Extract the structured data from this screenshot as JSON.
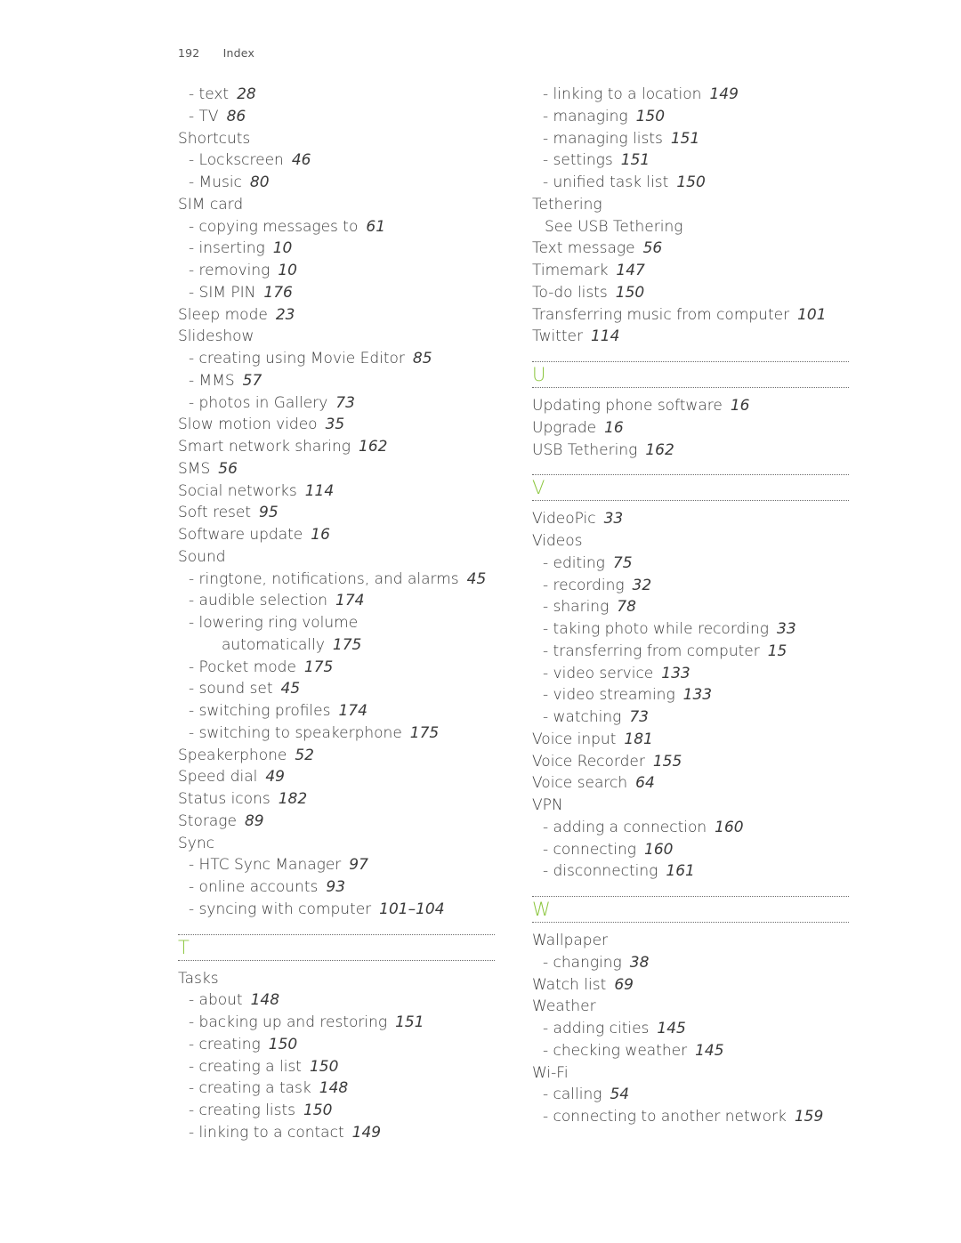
{
  "header": {
    "page_number": "192",
    "section": "Index"
  },
  "accent_color": "#8cc63f",
  "columns": [
    [
      {
        "type": "sub",
        "text": "- text",
        "page": "28"
      },
      {
        "type": "sub",
        "text": "- TV",
        "page": "86"
      },
      {
        "type": "main",
        "text": "Shortcuts",
        "page": ""
      },
      {
        "type": "sub",
        "text": "- Lockscreen",
        "page": "46"
      },
      {
        "type": "sub",
        "text": "- Music",
        "page": "80"
      },
      {
        "type": "main",
        "text": "SIM card",
        "page": ""
      },
      {
        "type": "sub",
        "text": "- copying messages to",
        "page": "61"
      },
      {
        "type": "sub",
        "text": "- inserting",
        "page": "10"
      },
      {
        "type": "sub",
        "text": "- removing",
        "page": "10"
      },
      {
        "type": "sub",
        "text": "- SIM PIN",
        "page": "176"
      },
      {
        "type": "main",
        "text": "Sleep mode",
        "page": "23"
      },
      {
        "type": "main",
        "text": "Slideshow",
        "page": ""
      },
      {
        "type": "sub",
        "text": "- creating using Movie Editor",
        "page": "85"
      },
      {
        "type": "sub",
        "text": "- MMS",
        "page": "57"
      },
      {
        "type": "sub",
        "text": "- photos in Gallery",
        "page": "73"
      },
      {
        "type": "main",
        "text": "Slow motion video",
        "page": "35"
      },
      {
        "type": "main",
        "text": "Smart network sharing",
        "page": "162"
      },
      {
        "type": "main",
        "text": "SMS",
        "page": "56"
      },
      {
        "type": "main",
        "text": "Social networks",
        "page": "114"
      },
      {
        "type": "main",
        "text": "Soft reset",
        "page": "95"
      },
      {
        "type": "main",
        "text": "Software update",
        "page": "16"
      },
      {
        "type": "main",
        "text": "Sound",
        "page": ""
      },
      {
        "type": "sub",
        "text": "- ringtone, notifications, and alarms",
        "page": "45"
      },
      {
        "type": "sub",
        "text": "- audible selection",
        "page": "174"
      },
      {
        "type": "sub",
        "text": "- lowering ring volume",
        "page": ""
      },
      {
        "type": "subcont",
        "text": "automatically",
        "page": "175"
      },
      {
        "type": "sub",
        "text": "- Pocket mode",
        "page": "175"
      },
      {
        "type": "sub",
        "text": "- sound set",
        "page": "45"
      },
      {
        "type": "sub",
        "text": "- switching profiles",
        "page": "174"
      },
      {
        "type": "sub",
        "text": "- switching to speakerphone",
        "page": "175"
      },
      {
        "type": "main",
        "text": "Speakerphone",
        "page": "52"
      },
      {
        "type": "main",
        "text": "Speed dial",
        "page": "49"
      },
      {
        "type": "main",
        "text": "Status icons",
        "page": "182"
      },
      {
        "type": "main",
        "text": "Storage",
        "page": "89"
      },
      {
        "type": "main",
        "text": "Sync",
        "page": ""
      },
      {
        "type": "sub",
        "text": "- HTC Sync Manager",
        "page": "97"
      },
      {
        "type": "sub",
        "text": "- online accounts",
        "page": "93"
      },
      {
        "type": "sub",
        "text": "- syncing with computer",
        "page": "101–104"
      },
      {
        "type": "letter",
        "text": "T"
      },
      {
        "type": "main",
        "text": "Tasks",
        "page": ""
      },
      {
        "type": "sub",
        "text": "- about",
        "page": "148"
      },
      {
        "type": "sub",
        "text": "- backing up and restoring",
        "page": "151"
      },
      {
        "type": "sub",
        "text": "- creating",
        "page": "150"
      },
      {
        "type": "sub",
        "text": "- creating a list",
        "page": "150"
      },
      {
        "type": "sub",
        "text": "- creating a task",
        "page": "148"
      },
      {
        "type": "sub",
        "text": "- creating lists",
        "page": "150"
      },
      {
        "type": "sub",
        "text": "- linking to a contact",
        "page": "149"
      }
    ],
    [
      {
        "type": "sub",
        "text": "- linking to a location",
        "page": "149"
      },
      {
        "type": "sub",
        "text": "- managing",
        "page": "150"
      },
      {
        "type": "sub",
        "text": "- managing lists",
        "page": "151"
      },
      {
        "type": "sub",
        "text": "- settings",
        "page": "151"
      },
      {
        "type": "sub",
        "text": "- unified task list",
        "page": "150"
      },
      {
        "type": "main",
        "text": "Tethering",
        "page": ""
      },
      {
        "type": "see",
        "text": "See USB Tethering",
        "page": ""
      },
      {
        "type": "main",
        "text": "Text message",
        "page": "56"
      },
      {
        "type": "main",
        "text": "Timemark",
        "page": "147"
      },
      {
        "type": "main",
        "text": "To-do lists",
        "page": "150"
      },
      {
        "type": "main",
        "text": "Transferring music from computer",
        "page": "101"
      },
      {
        "type": "main",
        "text": "Twitter",
        "page": "114"
      },
      {
        "type": "letter",
        "text": "U"
      },
      {
        "type": "main",
        "text": "Updating phone software",
        "page": "16"
      },
      {
        "type": "main",
        "text": "Upgrade",
        "page": "16"
      },
      {
        "type": "main",
        "text": "USB Tethering",
        "page": "162"
      },
      {
        "type": "letter",
        "text": "V"
      },
      {
        "type": "main",
        "text": "VideoPic",
        "page": "33"
      },
      {
        "type": "main",
        "text": "Videos",
        "page": ""
      },
      {
        "type": "sub",
        "text": "- editing",
        "page": "75"
      },
      {
        "type": "sub",
        "text": "- recording",
        "page": "32"
      },
      {
        "type": "sub",
        "text": "- sharing",
        "page": "78"
      },
      {
        "type": "sub",
        "text": "- taking photo while recording",
        "page": "33"
      },
      {
        "type": "sub",
        "text": "- transferring from computer",
        "page": "15"
      },
      {
        "type": "sub",
        "text": "- video service",
        "page": "133"
      },
      {
        "type": "sub",
        "text": "- video streaming",
        "page": "133"
      },
      {
        "type": "sub",
        "text": "- watching",
        "page": "73"
      },
      {
        "type": "main",
        "text": "Voice input",
        "page": "181"
      },
      {
        "type": "main",
        "text": "Voice Recorder",
        "page": "155"
      },
      {
        "type": "main",
        "text": "Voice search",
        "page": "64"
      },
      {
        "type": "main",
        "text": "VPN",
        "page": ""
      },
      {
        "type": "sub",
        "text": "- adding a connection",
        "page": "160"
      },
      {
        "type": "sub",
        "text": "- connecting",
        "page": "160"
      },
      {
        "type": "sub",
        "text": "- disconnecting",
        "page": "161"
      },
      {
        "type": "letter",
        "text": "W"
      },
      {
        "type": "main",
        "text": "Wallpaper",
        "page": ""
      },
      {
        "type": "sub",
        "text": "- changing",
        "page": "38"
      },
      {
        "type": "main",
        "text": "Watch list",
        "page": "69"
      },
      {
        "type": "main",
        "text": "Weather",
        "page": ""
      },
      {
        "type": "sub",
        "text": "- adding cities",
        "page": "145"
      },
      {
        "type": "sub",
        "text": "- checking weather",
        "page": "145"
      },
      {
        "type": "main",
        "text": "Wi-Fi",
        "page": ""
      },
      {
        "type": "sub",
        "text": "- calling",
        "page": "54"
      },
      {
        "type": "sub",
        "text": "- connecting to another network",
        "page": "159"
      }
    ]
  ]
}
